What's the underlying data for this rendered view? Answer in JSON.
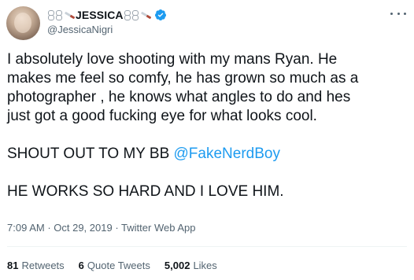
{
  "author": {
    "display_name": "JESSICA",
    "handle": "@JessicaNigri",
    "name_decorations": [
      "chain-icon",
      "knife-icon"
    ],
    "verified": true
  },
  "tweet": {
    "paragraph1": "I absolutely love shooting with my mans Ryan. He\nmakes me feel so comfy, he has grown so much as a\nphotographer , he knows what angles to do and hes\njust got a good fucking eye for what looks cool.",
    "shout_prefix": "SHOUT OUT TO MY BB ",
    "mention": "@FakeNerdBoy",
    "paragraph3": "HE WORKS SO HARD AND I LOVE HIM."
  },
  "meta": {
    "time": "7:09 AM",
    "separator": " · ",
    "date": "Oct 29, 2019",
    "client": "Twitter Web App"
  },
  "stats": {
    "retweets_count": "81",
    "retweets_label": "Retweets",
    "quotes_count": "6",
    "quotes_label": "Quote Tweets",
    "likes_count": "5,002",
    "likes_label": "Likes"
  },
  "colors": {
    "link": "#1d9bf0",
    "secondary_text": "#536471",
    "verified_badge": "#1d9bf0"
  }
}
